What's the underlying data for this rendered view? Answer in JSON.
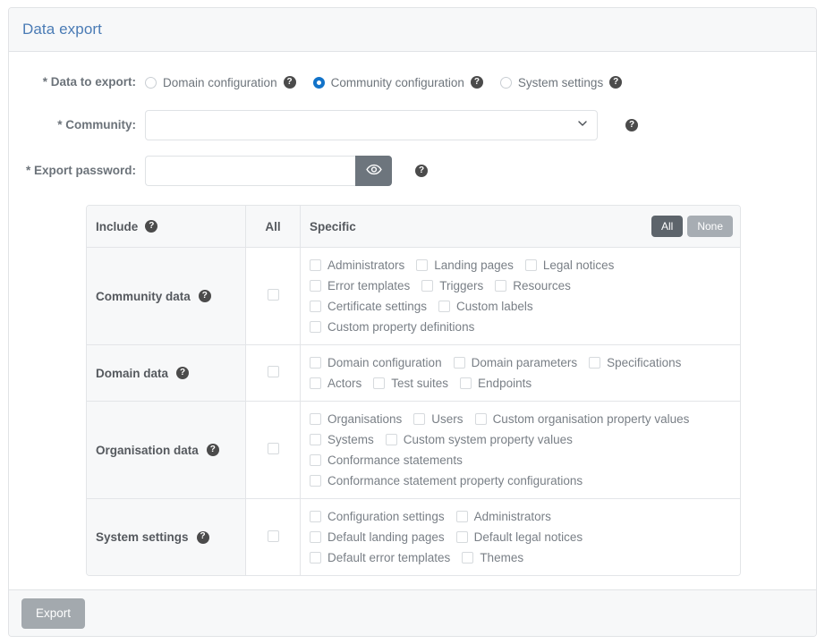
{
  "panel": {
    "title": "Data export"
  },
  "form": {
    "data_to_export": {
      "label": "* Data to export:",
      "options": [
        {
          "label": "Domain configuration",
          "checked": false
        },
        {
          "label": "Community configuration",
          "checked": true
        },
        {
          "label": "System settings",
          "checked": false
        }
      ],
      "help": "?"
    },
    "community": {
      "label": "* Community:",
      "value": "",
      "placeholder": "",
      "help": "?",
      "chevron_icon": "chevron-down-icon"
    },
    "export_password": {
      "label": "* Export password:",
      "value": "",
      "placeholder": "",
      "toggle_icon": "eye-icon",
      "help": "?"
    }
  },
  "table": {
    "headers": {
      "include": "Include",
      "include_help": "?",
      "all": "All",
      "specific": "Specific"
    },
    "buttons": {
      "all": "All",
      "none": "None"
    },
    "rows": [
      {
        "name": "Community data",
        "help": "?",
        "items": [
          "Administrators",
          "Landing pages",
          "Legal notices",
          "Error templates",
          "Triggers",
          "Resources",
          "Certificate settings",
          "Custom labels",
          "Custom property definitions"
        ]
      },
      {
        "name": "Domain data",
        "help": "?",
        "items": [
          "Domain configuration",
          "Domain parameters",
          "Specifications",
          "Actors",
          "Test suites",
          "Endpoints"
        ]
      },
      {
        "name": "Organisation data",
        "help": "?",
        "items": [
          "Organisations",
          "Users",
          "Custom organisation property values",
          "Systems",
          "Custom system property values",
          "Conformance statements",
          "Conformance statement property configurations"
        ]
      },
      {
        "name": "System settings",
        "help": "?",
        "items": [
          "Configuration settings",
          "Administrators",
          "Default landing pages",
          "Default legal notices",
          "Default error templates",
          "Themes"
        ]
      }
    ]
  },
  "footer": {
    "export_label": "Export"
  },
  "colors": {
    "title": "#4a7bb5",
    "radio_selected": "#1273c9",
    "btn_all": "#5d646b",
    "btn_none": "#a7adb3",
    "btn_export": "#a3a9ae",
    "help_icon": "#4b4b4b",
    "header_bg": "#f7f8f9",
    "border": "#e1e3e6"
  }
}
